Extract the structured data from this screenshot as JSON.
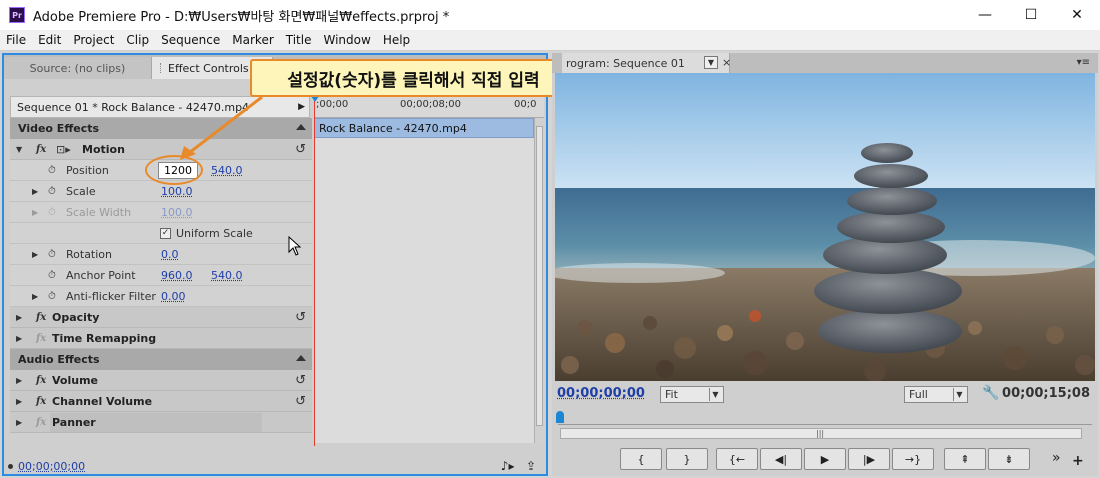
{
  "window": {
    "app_icon": "Pr",
    "title": "Adobe Premiere Pro - D:₩Users₩바탕 화면₩패널₩effects.prproj *",
    "minimize": "—",
    "maximize": "☐",
    "close": "✕"
  },
  "menu": [
    "File",
    "Edit",
    "Project",
    "Clip",
    "Sequence",
    "Marker",
    "Title",
    "Window",
    "Help"
  ],
  "left_panel": {
    "tab_source": "Source: (no clips)",
    "tab_effect_controls": "Effect Controls",
    "tab_close": "×",
    "sequence_label": "Sequence 01 * Rock Balance - 42470.mp4",
    "ruler_start": ";00;00",
    "ruler_mid": "00;00;08;00",
    "ruler_end": "00;0",
    "clip_name": "Rock Balance - 42470.mp4",
    "video_effects": "Video Effects",
    "audio_effects": "Audio Effects",
    "fx_icon": "fx",
    "motion": {
      "label": "Motion",
      "position_label": "Position",
      "position_x": "1200",
      "position_y": "540.0",
      "scale_label": "Scale",
      "scale_value": "100.0",
      "scale_width_label": "Scale Width",
      "scale_width_value": "100.0",
      "uniform_scale_label": "Uniform Scale",
      "uniform_scale_checked": true,
      "rotation_label": "Rotation",
      "rotation_value": "0.0",
      "anchor_label": "Anchor Point",
      "anchor_x": "960.0",
      "anchor_y": "540.0",
      "antiflicker_label": "Anti-flicker Filter",
      "antiflicker_value": "0.00"
    },
    "opacity": "Opacity",
    "time_remapping": "Time Remapping",
    "volume": "Volume",
    "channel_volume": "Channel Volume",
    "panner": "Panner",
    "bottom_timecode": "00;00;00;00"
  },
  "callout_text": "설정값(숫자)를 클릭해서 직접 입력",
  "right_panel": {
    "tab_label": "rogram: Sequence 01",
    "tab_close": "×",
    "timecode_current": "00;00;00;00",
    "zoom_select": "Fit",
    "quality_select": "Full",
    "timecode_duration": "00;00;15;08",
    "transport": {
      "mark_in": "{",
      "mark_out": "}",
      "go_to_in": "{←",
      "step_back": "◀|",
      "play": "▶",
      "step_forward": "|▶",
      "go_to_out": "→}",
      "lift": "⇞",
      "extract": "⇟"
    },
    "more": "»",
    "add": "+"
  },
  "colors": {
    "accent_blue": "#2d8ce0",
    "callout_border": "#e98a2a",
    "callout_bg": "#fdf5b9",
    "timecode_blue": "#1f3fa8",
    "playhead_red": "#e53a2e"
  }
}
